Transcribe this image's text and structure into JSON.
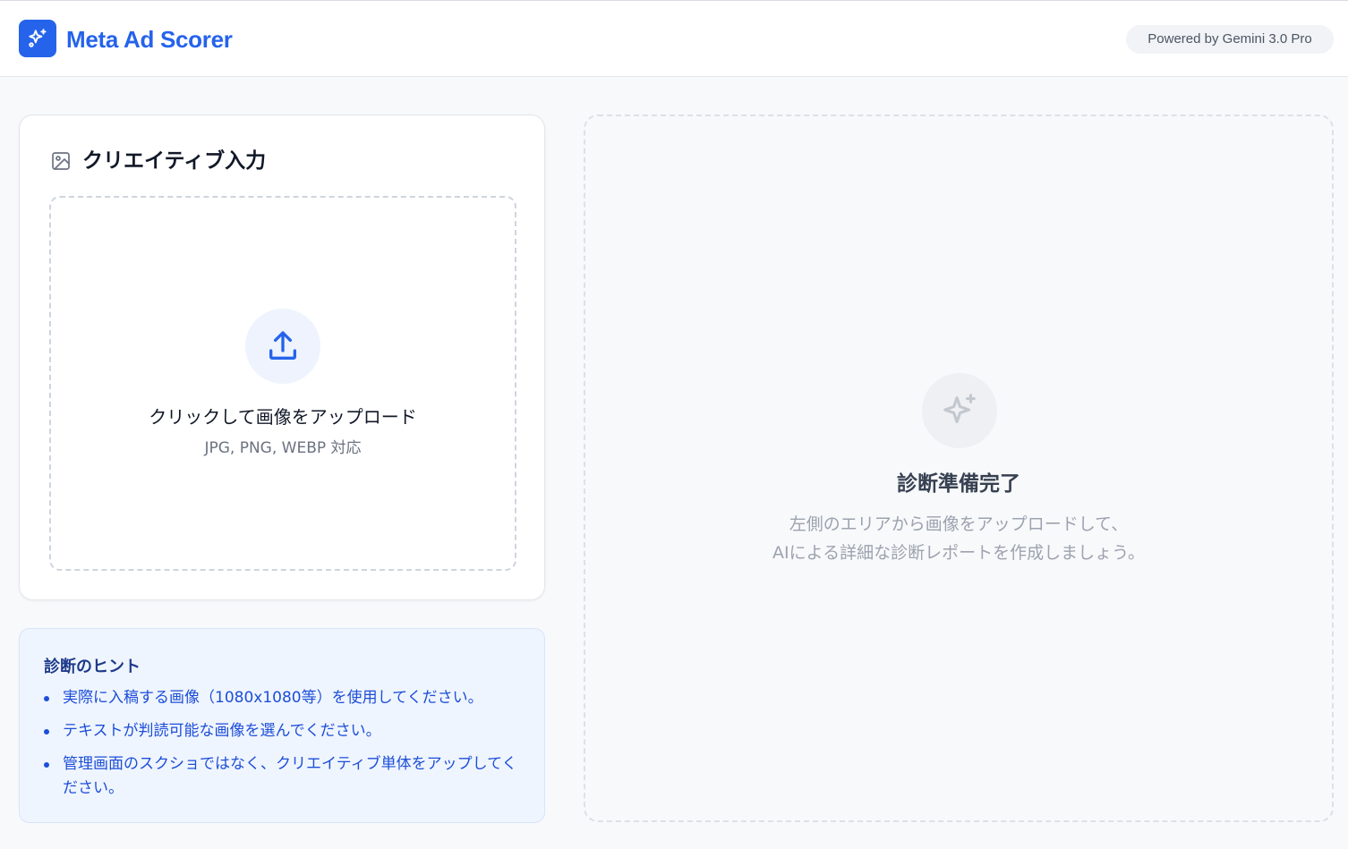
{
  "header": {
    "app_title": "Meta Ad Scorer",
    "logo_icon": "sparkles-icon",
    "powered_by": "Powered by Gemini 3.0 Pro"
  },
  "input_card": {
    "icon": "image-icon",
    "title": "クリエイティブ入力",
    "dropzone": {
      "icon": "upload-icon",
      "title": "クリックして画像をアップロード",
      "formats": "JPG, PNG, WEBP 対応"
    }
  },
  "hints": {
    "title": "診断のヒント",
    "items": [
      "実際に入稿する画像（1080x1080等）を使用してください。",
      "テキストが判読可能な画像を選んでください。",
      "管理画面のスクショではなく、クリエイティブ単体をアップしてください。"
    ]
  },
  "result_panel": {
    "icon": "sparkles-icon",
    "title": "診断準備完了",
    "line1": "左側のエリアから画像をアップロードして、",
    "line2": "AIによる詳細な診断レポートを作成しましょう。"
  },
  "colors": {
    "brand": "#2563eb",
    "hint_bg": "#eff5fe",
    "hint_text": "#1d4ed8"
  }
}
